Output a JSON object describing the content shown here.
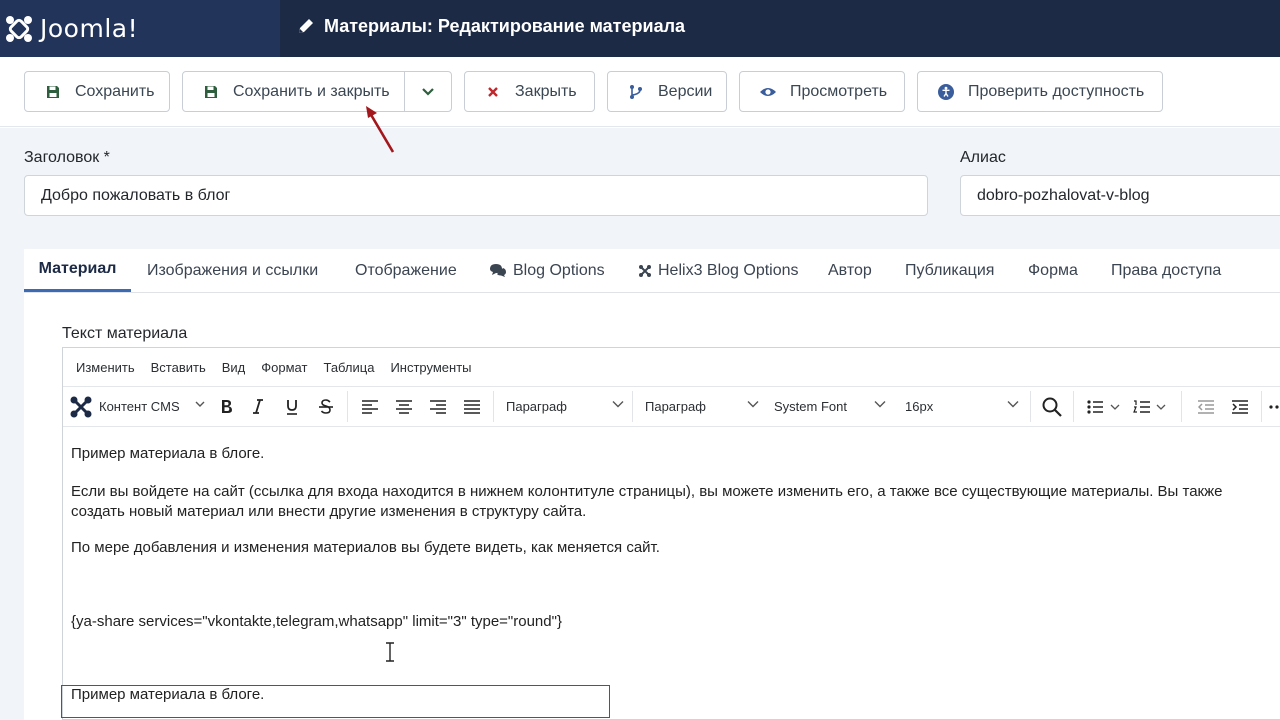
{
  "header": {
    "logo_text": "Joomla!",
    "title": "Материалы: Редактирование материала",
    "bar_color": "#1c2a46"
  },
  "toolbar": {
    "save": "Сохранить",
    "save_close": "Сохранить и закрыть",
    "close": "Закрыть",
    "versions": "Версии",
    "preview": "Просмотреть",
    "accessibility": "Проверить доступность"
  },
  "form": {
    "title_label": "Заголовок *",
    "title_value": "Добро пожаловать в блог",
    "alias_label": "Алиас",
    "alias_value": "dobro-pozhalovat-v-blog"
  },
  "tabs": [
    {
      "label": "Материал",
      "active": true
    },
    {
      "label": "Изображения и ссылки"
    },
    {
      "label": "Отображение"
    },
    {
      "label": "Blog Options",
      "icon": "comments-icon"
    },
    {
      "label": "Helix3 Blog Options",
      "icon": "helix-icon"
    },
    {
      "label": "Автор"
    },
    {
      "label": "Публикация"
    },
    {
      "label": "Форма"
    },
    {
      "label": "Права доступа"
    }
  ],
  "editor": {
    "label": "Текст материала",
    "menu": [
      "Изменить",
      "Вставить",
      "Вид",
      "Формат",
      "Таблица",
      "Инструменты"
    ],
    "cms_content": "Контент CMS",
    "block_format": "Параграф",
    "block_format2": "Параграф",
    "font_family": "System Font",
    "font_size": "16px",
    "paragraphs": [
      "Пример материала в блоге.",
      "Если вы войдете на сайт (ссылка для входа находится в нижнем колонтитуле страницы), вы можете изменить его, а также все существующие материалы. Вы также",
      "создать новый материал или внести другие изменения в структуру сайта.",
      "По мере добавления и изменения материалов вы будете видеть, как меняется сайт.",
      "{ya-share services=\"vkontakte,telegram,whatsapp\" limit=\"3\" type=\"round\"}",
      "Пример материала в блоге."
    ]
  },
  "colors": {
    "save_icon": "#2f5e3e",
    "close_icon": "#c0282d",
    "versions_icon": "#3a5d9c",
    "preview_icon": "#3a5d9c",
    "highlight_box": "#c0282d",
    "arrow": "#a3171c"
  }
}
